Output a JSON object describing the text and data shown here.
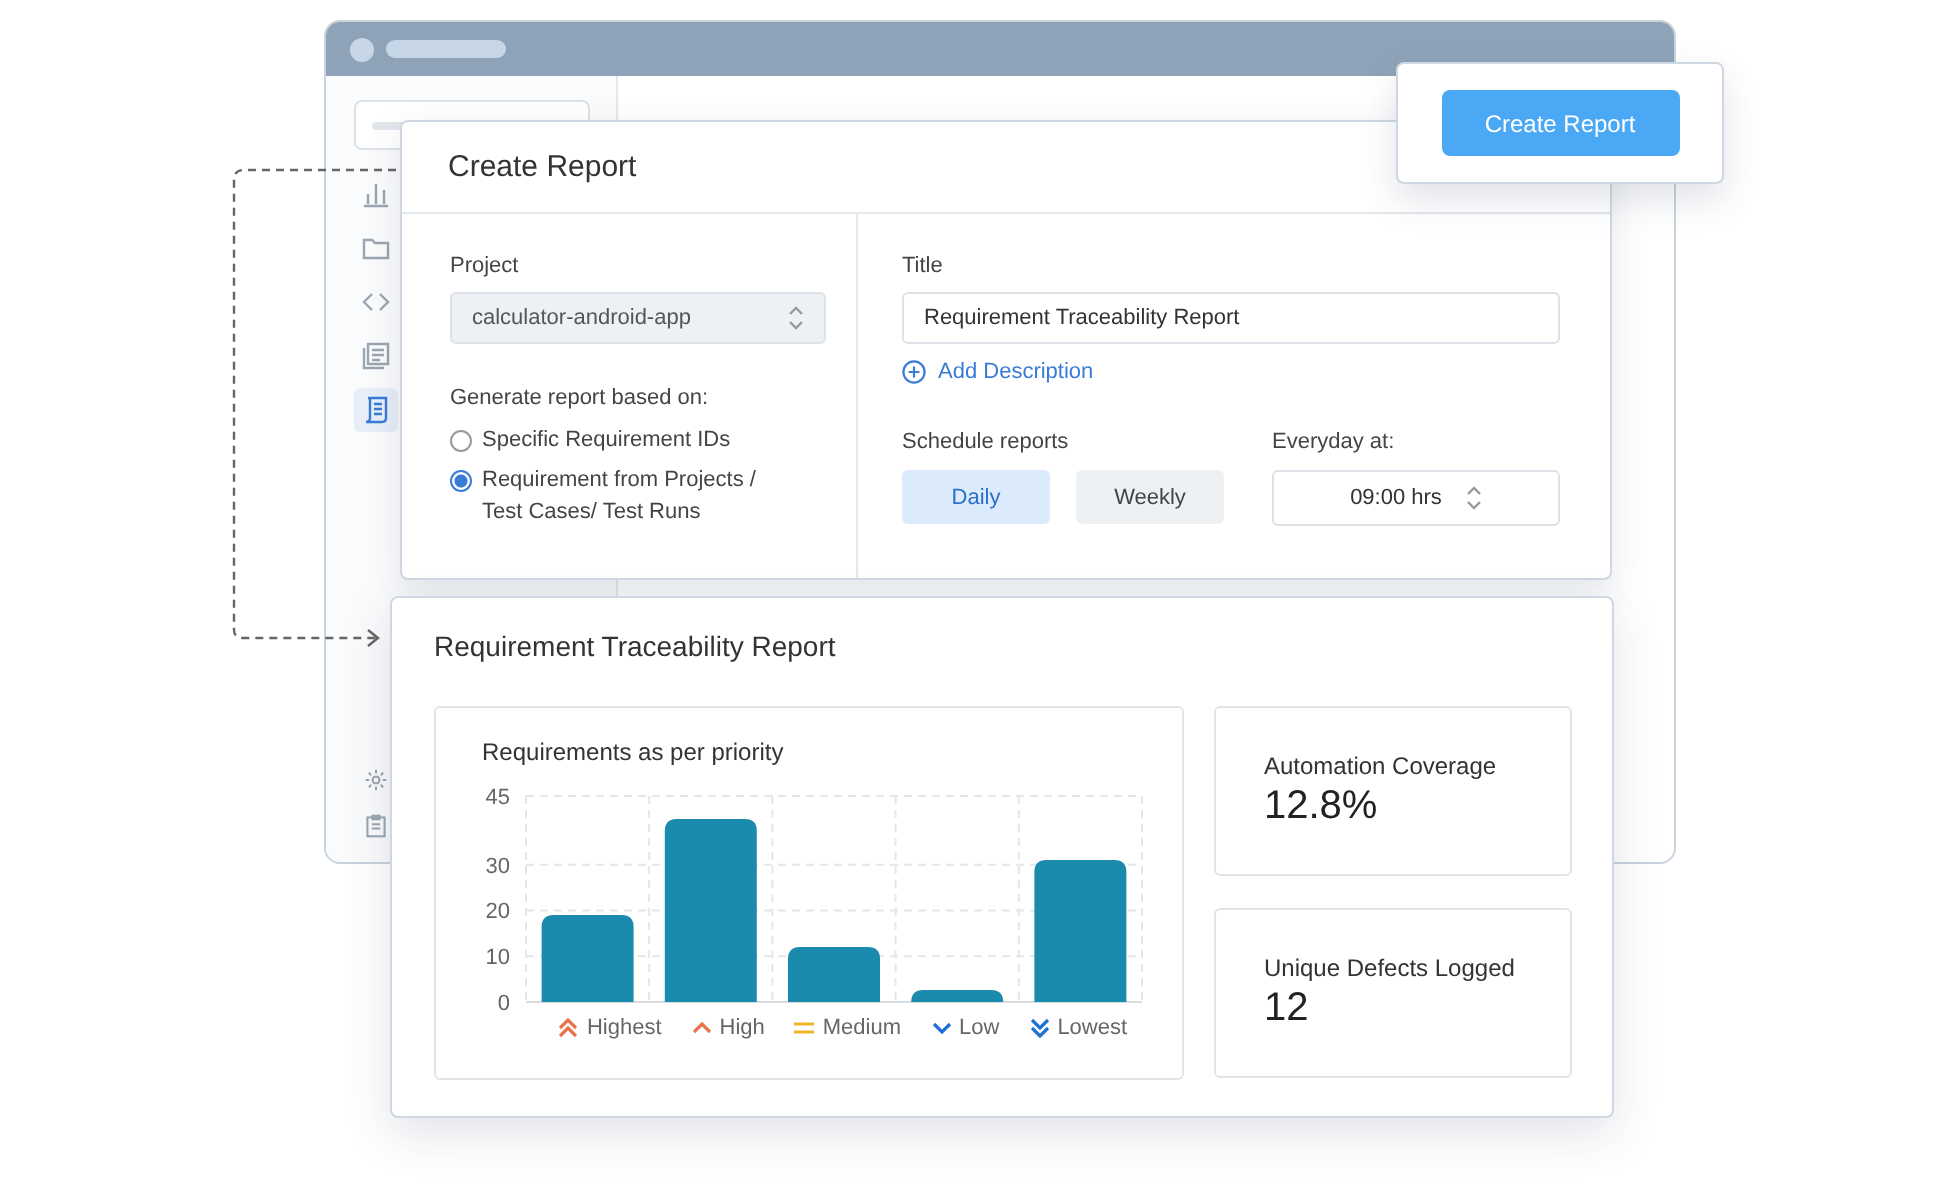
{
  "sidebar": {
    "items": [
      {
        "kind": "bars",
        "selected": false
      },
      {
        "kind": "folder",
        "selected": false
      },
      {
        "kind": "code",
        "selected": false
      },
      {
        "kind": "docs",
        "selected": false
      },
      {
        "kind": "report",
        "selected": true
      }
    ],
    "bottom_items": [
      {
        "kind": "gear",
        "selected": false
      },
      {
        "kind": "clipboard",
        "selected": false
      }
    ]
  },
  "create_button": {
    "label": "Create Report"
  },
  "create_form": {
    "title": "Create Report",
    "project": {
      "label": "Project",
      "value": "calculator-android-app"
    },
    "basis": {
      "label": "Generate report based on:",
      "options": [
        {
          "label": "Specific Requirement IDs",
          "selected": false
        },
        {
          "label": "Requirement from Projects / Test Cases/ Test Runs",
          "selected": true
        }
      ]
    },
    "title_field": {
      "label": "Title",
      "value": "Requirement Traceability Report"
    },
    "add_description": "Add Description",
    "schedule": {
      "label": "Schedule reports",
      "options": [
        {
          "label": "Daily",
          "selected": true
        },
        {
          "label": "Weekly",
          "selected": false
        }
      ]
    },
    "time": {
      "label": "Everyday at:",
      "value": "09:00 hrs"
    }
  },
  "report": {
    "title": "Requirement Traceability Report",
    "chart": {
      "chart_data": {
        "type": "bar",
        "title": "Requirements as per priority",
        "categories": [
          "Highest",
          "High",
          "Medium",
          "Low",
          "Lowest"
        ],
        "series": [
          {
            "color": "#1a8aad",
            "values": [
              19,
              40,
              12,
              2,
              31
            ]
          }
        ],
        "grid": true,
        "ylim": [
          0,
          45
        ],
        "yticks": [
          0,
          10,
          20,
          30,
          45
        ]
      },
      "legend": [
        {
          "kind": "double-up",
          "color": "#e8734a"
        },
        {
          "kind": "up",
          "color": "#e8734a"
        },
        {
          "kind": "equal",
          "color": "#f0b429"
        },
        {
          "kind": "down",
          "color": "#1f6fd6"
        },
        {
          "kind": "double-down",
          "color": "#1f6fd6"
        }
      ]
    },
    "stats": [
      {
        "label": "Automation Coverage",
        "value": "12.8%"
      },
      {
        "label": "Unique Defects Logged",
        "value": "12"
      }
    ]
  }
}
